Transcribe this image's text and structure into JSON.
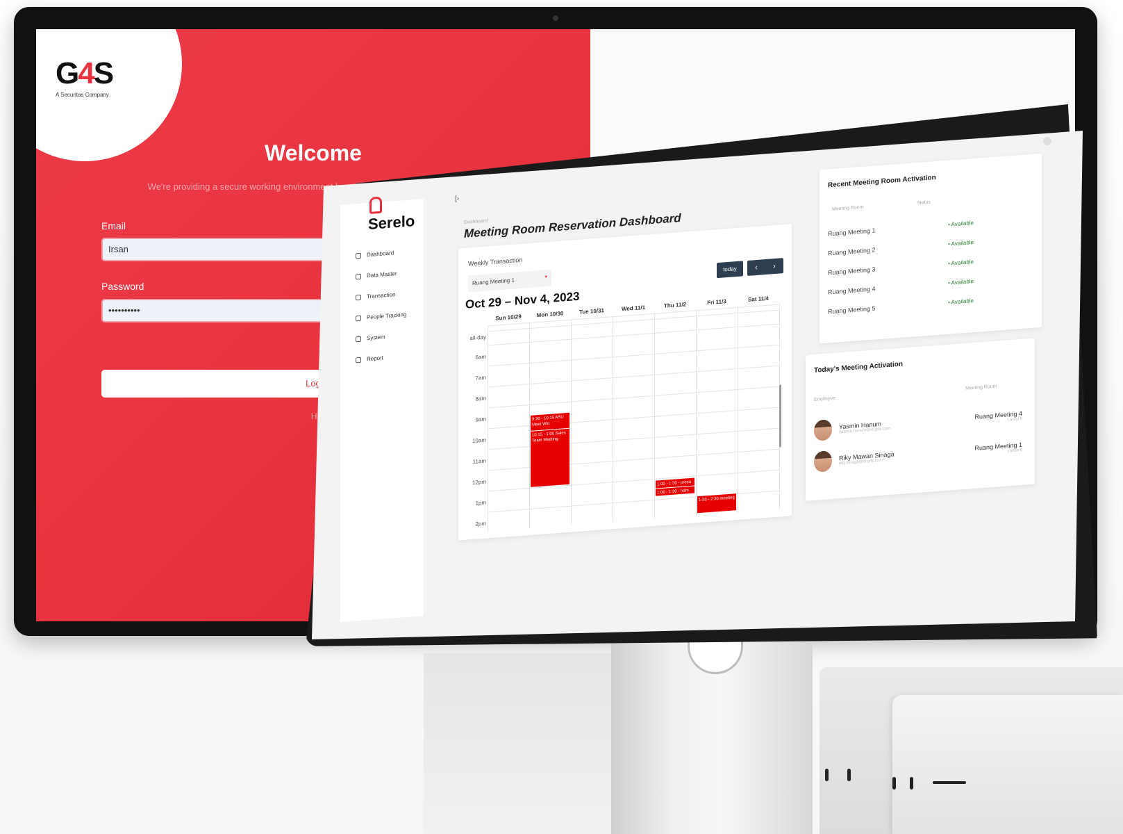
{
  "login": {
    "logo_text": "G4S",
    "logo_tagline": "A Securitas Company",
    "welcome": "Welcome",
    "subtitle": "We're providing a secure working environment by using a People Tracking Experience!",
    "email_label": "Email",
    "email_value": "Irsan",
    "password_label": "Password",
    "password_value": "••••••••••",
    "login_button": "Login",
    "signup_text": "Haven't sign up yet?"
  },
  "dashboard": {
    "brand": "Serelo",
    "nav": [
      {
        "label": "Dashboard",
        "icon": "home-icon"
      },
      {
        "label": "Data Master",
        "icon": "database-icon"
      },
      {
        "label": "Transaction",
        "icon": "transfer-icon"
      },
      {
        "label": "People Tracking",
        "icon": "tracking-icon"
      },
      {
        "label": "System",
        "icon": "system-icon"
      },
      {
        "label": "Report",
        "icon": "report-icon"
      }
    ],
    "breadcrumb": "Dashboard",
    "title": "Meeting Room Reservation Dashboard",
    "calendar": {
      "section_label": "Weekly Transaction",
      "room_select": "Ruang Meeting 1",
      "date_range": "Oct 29 – Nov 4, 2023",
      "today_button": "today",
      "prev_icon": "‹",
      "next_icon": "›",
      "days": [
        "Sun 10/29",
        "Mon 10/30",
        "Tue 10/31",
        "Wed 11/1",
        "Thu 11/2",
        "Fri 11/3",
        "Sat 11/4"
      ],
      "times": [
        "all-day",
        "6am",
        "7am",
        "8am",
        "9am",
        "10am",
        "11am",
        "12pm",
        "1pm",
        "2pm"
      ],
      "events": [
        {
          "text": "9:30 - 10:15 ASU Meet Wkt"
        },
        {
          "text": "10:15 - 1:00 Sales Team Meeting"
        },
        {
          "text": "1:00 - 1:30 - presa"
        },
        {
          "text": "1:00 - 1:30 - hdm"
        },
        {
          "text": "1:30 - 2:30 meeting"
        }
      ]
    },
    "recent": {
      "title": "Recent Meeting Room Activation",
      "col_room": "Meeting Room",
      "col_status": "Status",
      "rows": [
        {
          "room": "Ruang Meeting 1",
          "status": "Available"
        },
        {
          "room": "Ruang Meeting 2",
          "status": "Available"
        },
        {
          "room": "Ruang Meeting 3",
          "status": "Available"
        },
        {
          "room": "Ruang Meeting 4",
          "status": "Available"
        },
        {
          "room": "Ruang Meeting 5",
          "status": "Available"
        }
      ]
    },
    "today": {
      "title": "Today's Meeting Activation",
      "col_employee": "Employee",
      "col_room": "Meeting Room",
      "rows": [
        {
          "name": "Yasmin Hanum",
          "email": "yasmin.hanum@id.g4s.com",
          "room": "Ruang Meeting 4",
          "floor": "Lantai 8"
        },
        {
          "name": "Riky Mawan Sinaga",
          "email": "riky.sinaga@id.g4s.com",
          "room": "Ruang Meeting 1",
          "floor": "Lantai 8"
        }
      ]
    }
  },
  "colors": {
    "brand_red": "#e8333f",
    "event_red": "#e60000",
    "nav_dark": "#2c3e50",
    "available_green": "#43a047"
  }
}
